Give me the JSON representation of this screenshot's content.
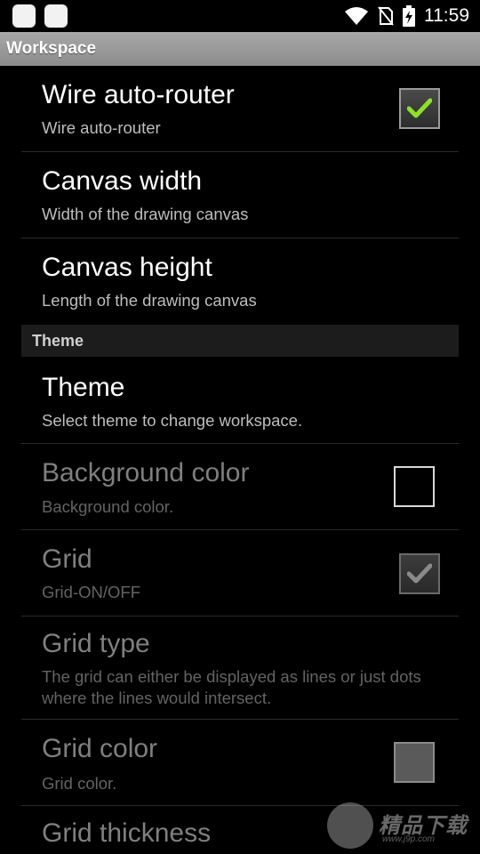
{
  "status_bar": {
    "time": "11:59",
    "icons": [
      "app-icon",
      "app-icon",
      "wifi-icon",
      "no-sim-icon",
      "battery-charging-icon"
    ]
  },
  "title_bar": {
    "title": "Workspace"
  },
  "items": [
    {
      "title": "Wire auto-router",
      "summary": "Wire auto-router",
      "widget": "checkbox",
      "checked": true,
      "enabled": true
    },
    {
      "title": "Canvas width",
      "summary": "Width of the drawing canvas",
      "enabled": true
    },
    {
      "title": "Canvas height",
      "summary": "Length of the drawing canvas",
      "enabled": true
    },
    {
      "category": "Theme"
    },
    {
      "title": "Theme",
      "summary": "Select theme to change workspace.",
      "enabled": true
    },
    {
      "title": "Background color",
      "summary": "Background color.",
      "widget": "color-swatch",
      "swatch_color": "#000000",
      "enabled": false
    },
    {
      "title": "Grid",
      "summary": "Grid-ON/OFF",
      "widget": "checkbox",
      "checked": true,
      "enabled": false
    },
    {
      "title": "Grid type",
      "summary": "The grid can either be displayed as lines or just dots where the lines would intersect.",
      "enabled": false
    },
    {
      "title": "Grid color",
      "summary": "Grid color.",
      "widget": "color-swatch",
      "swatch_color": "#5a5a5a",
      "enabled": false
    },
    {
      "title": "Grid thickness",
      "enabled": false
    }
  ],
  "watermark": {
    "text": "精品下载",
    "url": "www.j9p.com"
  },
  "colors": {
    "check_green": "#8ee02a",
    "title_bar": "#9a9a9a",
    "category_bg": "#1c1c1c"
  }
}
